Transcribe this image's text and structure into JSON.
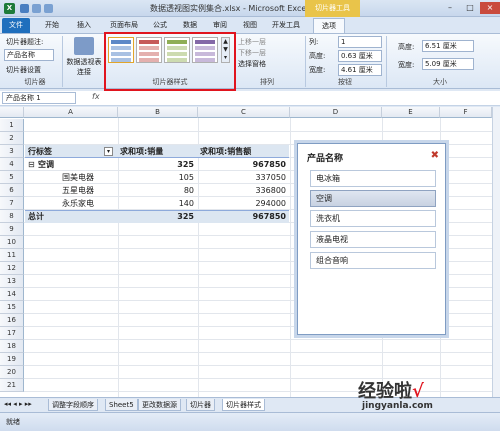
{
  "window": {
    "title": "数据透视图实例集合.xlsx - Microsoft Excel",
    "context_tool": "切片器工具",
    "quick_access": "X"
  },
  "tabs": [
    "文件",
    "开始",
    "插入",
    "页面布局",
    "公式",
    "数据",
    "审阅",
    "视图",
    "开发工具",
    "选项"
  ],
  "ribbon": {
    "slicer_caption_label": "切片器题注:",
    "slicer_caption_value": "产品名称",
    "slicer_settings": "切片器设置",
    "group_slicer": "切片器",
    "pivot_connections": "数据透视表连接",
    "group_styles": "切片器样式",
    "bring_forward": "上移一层",
    "send_backward": "下移一层",
    "selection_pane": "选择窗格",
    "group_arrange": "排列",
    "columns_label": "列:",
    "columns_value": "1",
    "height_label": "高度:",
    "height_value": "0.63 厘米",
    "width_label": "宽度:",
    "width_value": "4.61 厘米",
    "group_buttons": "按钮",
    "size_height_label": "高度:",
    "size_height_value": "6.51 厘米",
    "size_width_label": "宽度:",
    "size_width_value": "5.09 厘米",
    "group_size": "大小"
  },
  "formula_bar": {
    "name_box": "产品名称 1",
    "fx": "fx"
  },
  "columns": [
    "A",
    "B",
    "C",
    "D",
    "E",
    "F"
  ],
  "rows": [
    "1",
    "2",
    "3",
    "4",
    "5",
    "6",
    "7",
    "8",
    "9",
    "10",
    "11",
    "12",
    "13",
    "14",
    "15",
    "16",
    "17",
    "18",
    "19",
    "20",
    "21"
  ],
  "pivot": {
    "header_row_label": "行标签",
    "header_sales_qty": "求和项:销量",
    "header_sales_amt": "求和项:销售额",
    "group_name": "空调",
    "group_qty": "325",
    "group_amt": "967850",
    "rows": [
      {
        "name": "国美电器",
        "qty": "105",
        "amt": "337050"
      },
      {
        "name": "五星电器",
        "qty": "80",
        "amt": "336800"
      },
      {
        "name": "永乐家电",
        "qty": "140",
        "amt": "294000"
      }
    ],
    "total_label": "总计",
    "total_qty": "325",
    "total_amt": "967850"
  },
  "slicer": {
    "title": "产品名称",
    "items": [
      "电冰箱",
      "空调",
      "洗衣机",
      "液晶电视",
      "组合音响"
    ],
    "selected": "空调"
  },
  "sheet_tabs": [
    "调整字段顺序",
    "Sheet5",
    "更改数据源",
    "切片器",
    "切片器样式"
  ],
  "active_sheet": "切片器样式",
  "status": "就绪",
  "watermark": {
    "text": "经验啦",
    "check": "√",
    "url": "jingyanla.com"
  },
  "colors": {
    "accent_blue": "#1f6fbd",
    "highlight_red": "#e0141e",
    "context_yellow": "#e9c44a"
  }
}
